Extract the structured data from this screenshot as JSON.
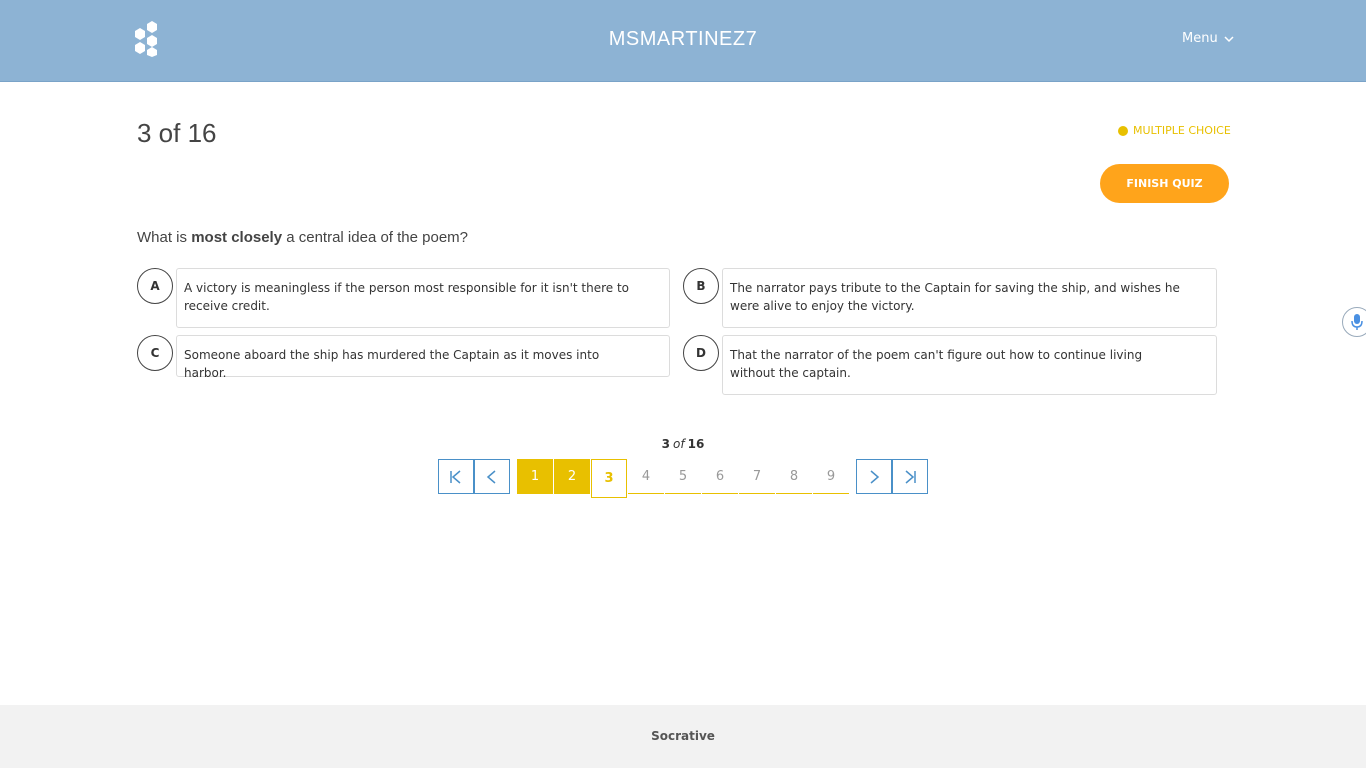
{
  "header": {
    "brand": "MSMARTINEZ7",
    "menu_label": "Menu",
    "logo_icon": "honeycomb-logo-icon"
  },
  "quiz": {
    "counter": "3 of 16",
    "question_type": "MULTIPLE CHOICE",
    "question_type_color": "#e8c000",
    "finish_label": "FINISH QUIZ",
    "finish_color": "#ffa41b"
  },
  "question": {
    "prefix": "What is ",
    "emphasis": "most closely",
    "suffix": " a central idea of the poem?"
  },
  "options": [
    {
      "letter": "A",
      "text": "A victory is meaningless if the person most responsible for it isn't there to receive credit."
    },
    {
      "letter": "B",
      "text": "The narrator pays tribute to the Captain for saving the ship, and wishes he were alive to enjoy the victory."
    },
    {
      "letter": "C",
      "text": "Someone aboard the ship has murdered the Captain as it moves into harbor."
    },
    {
      "letter": "D",
      "text": "That the narrator of the poem can't figure out how to continue living without the captain."
    }
  ],
  "pagination": {
    "current": "3",
    "of_word": "of",
    "total": "16",
    "pages": [
      "1",
      "2",
      "3",
      "4",
      "5",
      "6",
      "7",
      "8",
      "9"
    ],
    "answered": [
      "1",
      "2"
    ]
  },
  "footer": {
    "text": "Socrative"
  }
}
